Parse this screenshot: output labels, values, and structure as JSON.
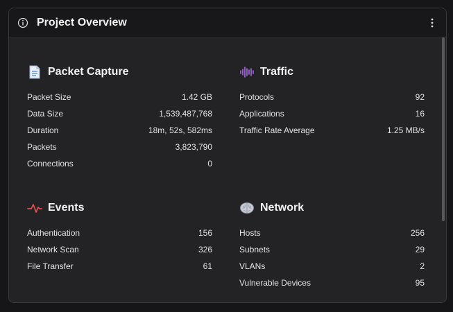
{
  "panel": {
    "title": "Project Overview"
  },
  "sections": {
    "packet_capture": {
      "title": "Packet Capture",
      "icon": "document-icon",
      "rows": [
        {
          "label": "Packet Size",
          "value": "1.42 GB"
        },
        {
          "label": "Data Size",
          "value": "1,539,487,768"
        },
        {
          "label": "Duration",
          "value": "18m, 52s, 582ms"
        },
        {
          "label": "Packets",
          "value": "3,823,790"
        },
        {
          "label": "Connections",
          "value": "0"
        }
      ]
    },
    "traffic": {
      "title": "Traffic",
      "icon": "waveform-icon",
      "accent": "#a46ee8",
      "rows": [
        {
          "label": "Protocols",
          "value": "92"
        },
        {
          "label": "Applications",
          "value": "16"
        },
        {
          "label": "Traffic Rate Average",
          "value": "1.25 MB/s"
        }
      ]
    },
    "events": {
      "title": "Events",
      "icon": "pulse-icon",
      "accent": "#e05050",
      "rows": [
        {
          "label": "Authentication",
          "value": "156"
        },
        {
          "label": "Network Scan",
          "value": "326"
        },
        {
          "label": "File Transfer",
          "value": "61"
        }
      ]
    },
    "network": {
      "title": "Network",
      "icon": "brain-icon",
      "rows": [
        {
          "label": "Hosts",
          "value": "256"
        },
        {
          "label": "Subnets",
          "value": "29"
        },
        {
          "label": "VLANs",
          "value": "2"
        },
        {
          "label": "Vulnerable Devices",
          "value": "95"
        }
      ]
    }
  },
  "colors": {
    "background": "#161618",
    "panel": "#232326",
    "header": "#18181a",
    "text": "#e3e3e3"
  }
}
